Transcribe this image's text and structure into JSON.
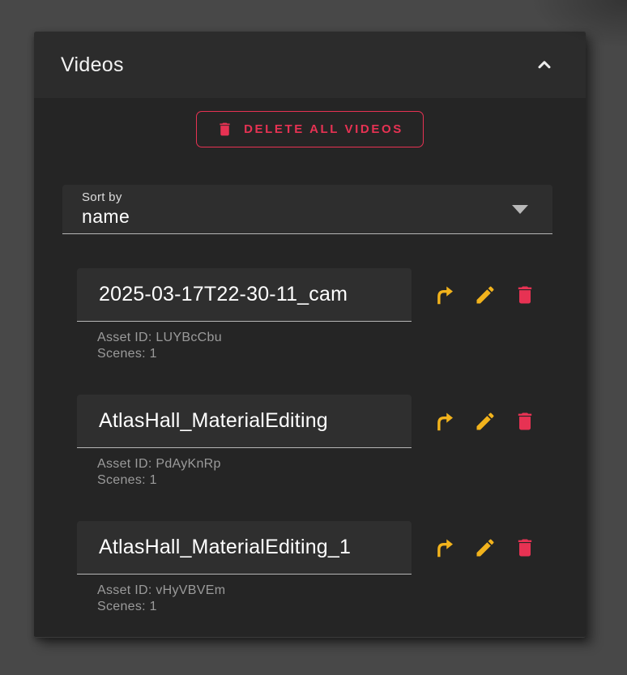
{
  "colors": {
    "accent_red": "#e73253",
    "accent_yellow": "#f2b31c",
    "panel_bg": "#252525",
    "header_bg": "#2c2c2c"
  },
  "panel": {
    "title": "Videos",
    "delete_all_button": {
      "label": "DELETE ALL VIDEOS"
    },
    "sort": {
      "label": "Sort by",
      "value": "name"
    },
    "videos": [
      {
        "name": "2025-03-17T22-30-11_cam",
        "asset_id_text": "Asset ID: LUYBcCbu",
        "scenes_text": "Scenes: 1"
      },
      {
        "name": "AtlasHall_MaterialEditing",
        "asset_id_text": "Asset ID: PdAyKnRp",
        "scenes_text": "Scenes: 1"
      },
      {
        "name": "AtlasHall_MaterialEditing_1",
        "asset_id_text": "Asset ID: vHyVBVEm",
        "scenes_text": "Scenes: 1"
      }
    ]
  }
}
